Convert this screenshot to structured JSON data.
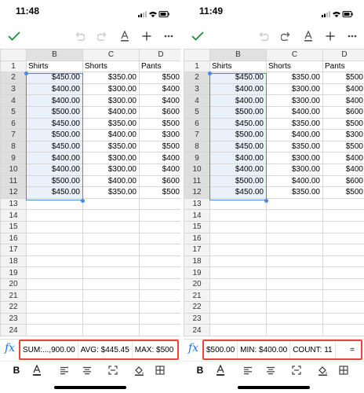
{
  "left": {
    "time": "11:48",
    "stats": [
      "SUM:...,900.00",
      "AVG: $445.45",
      "MAX: $500"
    ]
  },
  "right": {
    "time": "11:49",
    "stats": [
      "$500.00",
      "MIN: $400.00",
      "COUNT: 11",
      "="
    ]
  },
  "sheet": {
    "col_headers": [
      "B",
      "C",
      "D"
    ],
    "row_numbers": [
      "1",
      "2",
      "3",
      "4",
      "5",
      "6",
      "7",
      "8",
      "9",
      "10",
      "11",
      "12",
      "13",
      "14",
      "15",
      "16",
      "17",
      "18",
      "19",
      "20",
      "21",
      "22",
      "23",
      "24"
    ],
    "headers": [
      "Shirts",
      "Shorts",
      "Pants"
    ],
    "rows": [
      [
        "$450.00",
        "$350.00",
        "$500"
      ],
      [
        "$400.00",
        "$300.00",
        "$400"
      ],
      [
        "$400.00",
        "$300.00",
        "$400"
      ],
      [
        "$500.00",
        "$400.00",
        "$600"
      ],
      [
        "$450.00",
        "$350.00",
        "$500"
      ],
      [
        "$500.00",
        "$400.00",
        "$300"
      ],
      [
        "$450.00",
        "$350.00",
        "$500"
      ],
      [
        "$400.00",
        "$300.00",
        "$400"
      ],
      [
        "$400.00",
        "$300.00",
        "$400"
      ],
      [
        "$500.00",
        "$400.00",
        "$600"
      ],
      [
        "$450.00",
        "$350.00",
        "$500"
      ]
    ]
  },
  "fx_label": "fx",
  "format": {
    "bold": "B",
    "text_color": "A"
  },
  "colors": {
    "accent": "#1a73e8",
    "selection": "#4a86e8",
    "highlight": "#e8453c",
    "check": "#1e8e3e"
  }
}
